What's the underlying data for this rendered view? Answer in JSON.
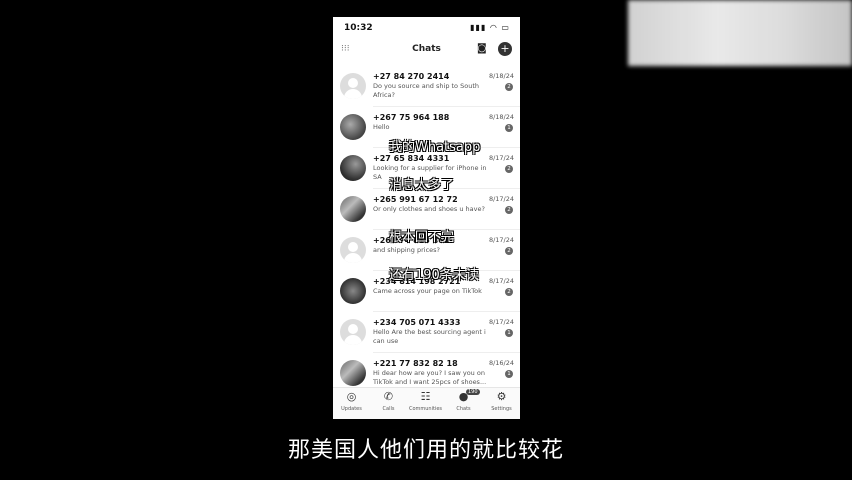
{
  "status": {
    "time": "10:32",
    "signal": "▮▮▮ ◠ ▭"
  },
  "header": {
    "title": "Chats",
    "left_icon": "⁝⁝⁝"
  },
  "chats": [
    {
      "name": "+27 84 270 2414",
      "date": "8/18/24",
      "message": "Do you source and ship to South Africa?",
      "badge": "2"
    },
    {
      "name": "+267 75 964 188",
      "date": "8/18/24",
      "message": "Hello",
      "badge": "1"
    },
    {
      "name": "+27 65 834 4331",
      "date": "8/17/24",
      "message": "Looking for a supplier for iPhone in SA",
      "badge": "2"
    },
    {
      "name": "+265 991 67 12 72",
      "date": "8/17/24",
      "message": "Or only clothes and shoes u have?",
      "badge": "2"
    },
    {
      "name": "+267 74 815 861",
      "date": "8/17/24",
      "message": "and shipping prices?",
      "badge": "2"
    },
    {
      "name": "+234 814 198 2721",
      "date": "8/17/24",
      "message": "Came across your page on TikTok",
      "badge": "2"
    },
    {
      "name": "+234 705 071 4333",
      "date": "8/17/24",
      "message": "Hello Are the best sourcing agent i can use",
      "badge": "1"
    },
    {
      "name": "+221 77 832 82 18",
      "date": "8/16/24",
      "message": "Hi dear how are you? I saw you on TikTok and I want 25pcs of shoes...",
      "badge": "1"
    }
  ],
  "tabs": [
    {
      "label": "Updates",
      "icon": "◎"
    },
    {
      "label": "Calls",
      "icon": "✆"
    },
    {
      "label": "Communities",
      "icon": "☷"
    },
    {
      "label": "Chats",
      "icon": "●",
      "count": "190"
    },
    {
      "label": "Settings",
      "icon": "⚙"
    }
  ],
  "overlays": {
    "line1": "我的Whatsapp",
    "line2": "消息太多了",
    "line3": "根本回不完",
    "line4": "还有190条未读"
  },
  "caption": "那美国人他们用的就比较花"
}
